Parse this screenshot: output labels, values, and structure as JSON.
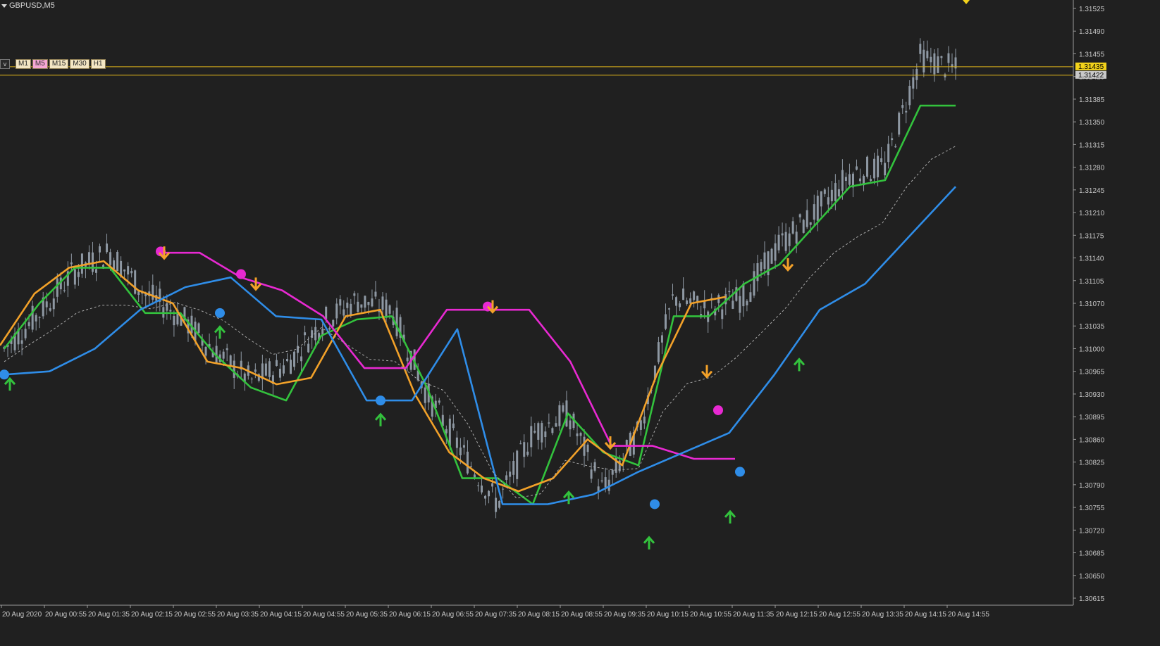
{
  "window": {
    "symbol_label": "GBPUSD,M5"
  },
  "timeframes": [
    {
      "label": "M1",
      "active": false
    },
    {
      "label": "M5",
      "active": true
    },
    {
      "label": "M15",
      "active": false
    },
    {
      "label": "M30",
      "active": false
    },
    {
      "label": "H1",
      "active": false
    }
  ],
  "timeframe_toggle": "v",
  "colors": {
    "background": "#202020",
    "axis": "#9a9a9a",
    "candle": "#8e98a3",
    "level_line": "#d9b11a",
    "bid_tag": "#f2d21b",
    "ask_tag": "#c8c8c8",
    "green": "#33c23d",
    "orange": "#f2a129",
    "magenta": "#e829d2",
    "blue": "#2f8de8",
    "ma_dashed": "#aaaaaa"
  },
  "price_axis": {
    "min": 1.30615,
    "max": 1.31525,
    "labels": [
      "1.31525",
      "1.31490",
      "1.31455",
      "1.31420",
      "1.31385",
      "1.31350",
      "1.31315",
      "1.31280",
      "1.31245",
      "1.31210",
      "1.31175",
      "1.31140",
      "1.31105",
      "1.31070",
      "1.31035",
      "1.31000",
      "1.30965",
      "1.30930",
      "1.30895",
      "1.30860",
      "1.30825",
      "1.30790",
      "1.30755",
      "1.30720",
      "1.30685",
      "1.30650",
      "1.30615"
    ]
  },
  "time_axis": {
    "labels": [
      "20 Aug 2020",
      "20 Aug 00:55",
      "20 Aug 01:35",
      "20 Aug 02:15",
      "20 Aug 02:55",
      "20 Aug 03:35",
      "20 Aug 04:15",
      "20 Aug 04:55",
      "20 Aug 05:35",
      "20 Aug 06:15",
      "20 Aug 06:55",
      "20 Aug 07:35",
      "20 Aug 08:15",
      "20 Aug 08:55",
      "20 Aug 09:35",
      "20 Aug 10:15",
      "20 Aug 10:55",
      "20 Aug 11:35",
      "20 Aug 12:15",
      "20 Aug 12:55",
      "20 Aug 13:35",
      "20 Aug 14:15",
      "20 Aug 14:55"
    ]
  },
  "price_tags": {
    "bid": "1.31435",
    "ask": "1.31422"
  },
  "levels": {
    "bid": 1.31435,
    "ask": 1.31422
  },
  "chart_data": {
    "type": "candlestick",
    "symbol": "GBPUSD",
    "timeframe": "M5",
    "ylim": [
      1.30615,
      1.31525
    ],
    "x": [
      "20 Aug 2020",
      "20 Aug 00:55",
      "20 Aug 01:35",
      "20 Aug 02:15",
      "20 Aug 02:55",
      "20 Aug 03:35",
      "20 Aug 04:15",
      "20 Aug 04:55",
      "20 Aug 05:35",
      "20 Aug 06:15",
      "20 Aug 06:55",
      "20 Aug 07:35",
      "20 Aug 08:15",
      "20 Aug 08:55",
      "20 Aug 09:35",
      "20 Aug 10:15",
      "20 Aug 10:55",
      "20 Aug 11:35",
      "20 Aug 12:15",
      "20 Aug 12:55",
      "20 Aug 13:35",
      "20 Aug 14:15",
      "20 Aug 14:55"
    ],
    "close_series": [
      1.31,
      1.31055,
      1.3112,
      1.3115,
      1.31085,
      1.3105,
      1.30995,
      1.3095,
      1.30975,
      1.3104,
      1.31075,
      1.3106,
      1.3093,
      1.3084,
      1.3076,
      1.3087,
      1.309,
      1.3078,
      1.3087,
      1.3108,
      1.3106,
      1.3108,
      1.3116,
      1.3121,
      1.3127,
      1.3128,
      1.3145,
      1.3143
    ],
    "series": [
      {
        "color": "green",
        "values": [
          1.31,
          1.3107,
          1.31125,
          1.31125,
          1.31055,
          1.31055,
          1.3099,
          1.3094,
          1.3092,
          1.3102,
          1.31045,
          1.3105,
          1.3094,
          1.308,
          1.308,
          1.3076,
          1.309,
          1.3084,
          1.3082,
          1.3105,
          1.3105,
          1.311,
          1.3113,
          1.3119,
          1.3125,
          1.3126,
          1.31375,
          1.31375
        ]
      },
      {
        "color": "orange",
        "values": [
          1.31005,
          1.31085,
          1.31125,
          1.31135,
          1.3109,
          1.3107,
          1.3098,
          1.3097,
          1.30945,
          1.30955,
          1.3105,
          1.3106,
          1.3093,
          1.3084,
          1.308,
          1.3078,
          1.308,
          1.3086,
          1.3082,
          1.3096,
          1.3107,
          1.3108
        ]
      },
      {
        "color": "magenta",
        "values": [
          1.31148,
          1.31148,
          1.3111,
          1.3109,
          1.3105,
          1.3097,
          1.3097,
          1.3106,
          1.3106,
          1.3106,
          1.3098,
          1.3085,
          1.3085,
          1.3083,
          1.3083
        ]
      },
      {
        "color": "blue",
        "values": [
          1.3096,
          1.30965,
          1.31,
          1.3106,
          1.31095,
          1.3111,
          1.3105,
          1.31045,
          1.3092,
          1.3092,
          1.3103,
          1.3076,
          1.3076,
          1.30775,
          1.3081,
          1.3084,
          1.3087,
          1.3096,
          1.3106,
          1.311,
          1.31175,
          1.3125
        ]
      }
    ],
    "markers": [
      {
        "type": "dot",
        "color": "magenta",
        "price": 1.3115
      },
      {
        "type": "arrow_down",
        "color": "orange",
        "price": 1.31148
      },
      {
        "type": "dot",
        "color": "magenta",
        "price": 1.31115
      },
      {
        "type": "arrow_down",
        "color": "orange",
        "price": 1.311
      },
      {
        "type": "dot",
        "color": "blue",
        "price": 1.31055
      },
      {
        "type": "arrow_up",
        "color": "green",
        "price": 1.31025
      },
      {
        "type": "dot",
        "color": "blue",
        "price": 1.3096
      },
      {
        "type": "arrow_up",
        "color": "green",
        "price": 1.30945
      },
      {
        "type": "dot",
        "color": "blue",
        "price": 1.3092
      },
      {
        "type": "arrow_up",
        "color": "green",
        "price": 1.3089
      },
      {
        "type": "dot",
        "color": "magenta",
        "price": 1.31065
      },
      {
        "type": "arrow_down",
        "color": "orange",
        "price": 1.31065
      },
      {
        "type": "arrow_down",
        "color": "orange",
        "price": 1.30855
      },
      {
        "type": "arrow_up",
        "color": "green",
        "price": 1.3077
      },
      {
        "type": "dot",
        "color": "blue",
        "price": 1.3076
      },
      {
        "type": "arrow_up",
        "color": "green",
        "price": 1.307
      },
      {
        "type": "arrow_down",
        "color": "orange",
        "price": 1.30965
      },
      {
        "type": "dot",
        "color": "magenta",
        "price": 1.30905
      },
      {
        "type": "arrow_up",
        "color": "green",
        "price": 1.3074
      },
      {
        "type": "dot",
        "color": "blue",
        "price": 1.3081
      },
      {
        "type": "arrow_down",
        "color": "orange",
        "price": 1.3113
      },
      {
        "type": "arrow_up",
        "color": "green",
        "price": 1.30975
      }
    ]
  }
}
